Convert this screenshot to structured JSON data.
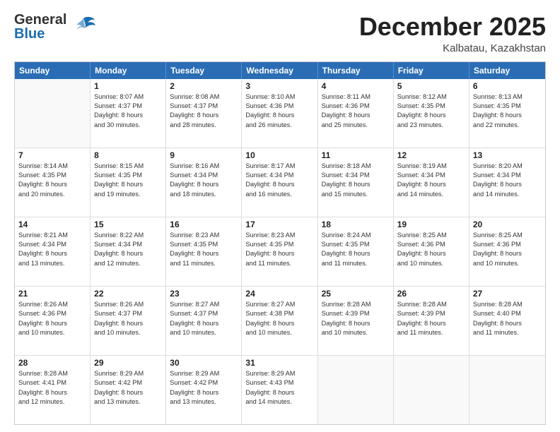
{
  "logo": {
    "line1": "General",
    "line2": "Blue"
  },
  "title": "December 2025",
  "location": "Kalbatau, Kazakhstan",
  "header_days": [
    "Sunday",
    "Monday",
    "Tuesday",
    "Wednesday",
    "Thursday",
    "Friday",
    "Saturday"
  ],
  "weeks": [
    [
      {
        "day": "",
        "sunrise": "",
        "sunset": "",
        "daylight": ""
      },
      {
        "day": "1",
        "sunrise": "Sunrise: 8:07 AM",
        "sunset": "Sunset: 4:37 PM",
        "daylight": "Daylight: 8 hours",
        "daylight2": "and 30 minutes."
      },
      {
        "day": "2",
        "sunrise": "Sunrise: 8:08 AM",
        "sunset": "Sunset: 4:37 PM",
        "daylight": "Daylight: 8 hours",
        "daylight2": "and 28 minutes."
      },
      {
        "day": "3",
        "sunrise": "Sunrise: 8:10 AM",
        "sunset": "Sunset: 4:36 PM",
        "daylight": "Daylight: 8 hours",
        "daylight2": "and 26 minutes."
      },
      {
        "day": "4",
        "sunrise": "Sunrise: 8:11 AM",
        "sunset": "Sunset: 4:36 PM",
        "daylight": "Daylight: 8 hours",
        "daylight2": "and 25 minutes."
      },
      {
        "day": "5",
        "sunrise": "Sunrise: 8:12 AM",
        "sunset": "Sunset: 4:35 PM",
        "daylight": "Daylight: 8 hours",
        "daylight2": "and 23 minutes."
      },
      {
        "day": "6",
        "sunrise": "Sunrise: 8:13 AM",
        "sunset": "Sunset: 4:35 PM",
        "daylight": "Daylight: 8 hours",
        "daylight2": "and 22 minutes."
      }
    ],
    [
      {
        "day": "7",
        "sunrise": "Sunrise: 8:14 AM",
        "sunset": "Sunset: 4:35 PM",
        "daylight": "Daylight: 8 hours",
        "daylight2": "and 20 minutes."
      },
      {
        "day": "8",
        "sunrise": "Sunrise: 8:15 AM",
        "sunset": "Sunset: 4:35 PM",
        "daylight": "Daylight: 8 hours",
        "daylight2": "and 19 minutes."
      },
      {
        "day": "9",
        "sunrise": "Sunrise: 8:16 AM",
        "sunset": "Sunset: 4:34 PM",
        "daylight": "Daylight: 8 hours",
        "daylight2": "and 18 minutes."
      },
      {
        "day": "10",
        "sunrise": "Sunrise: 8:17 AM",
        "sunset": "Sunset: 4:34 PM",
        "daylight": "Daylight: 8 hours",
        "daylight2": "and 16 minutes."
      },
      {
        "day": "11",
        "sunrise": "Sunrise: 8:18 AM",
        "sunset": "Sunset: 4:34 PM",
        "daylight": "Daylight: 8 hours",
        "daylight2": "and 15 minutes."
      },
      {
        "day": "12",
        "sunrise": "Sunrise: 8:19 AM",
        "sunset": "Sunset: 4:34 PM",
        "daylight": "Daylight: 8 hours",
        "daylight2": "and 14 minutes."
      },
      {
        "day": "13",
        "sunrise": "Sunrise: 8:20 AM",
        "sunset": "Sunset: 4:34 PM",
        "daylight": "Daylight: 8 hours",
        "daylight2": "and 14 minutes."
      }
    ],
    [
      {
        "day": "14",
        "sunrise": "Sunrise: 8:21 AM",
        "sunset": "Sunset: 4:34 PM",
        "daylight": "Daylight: 8 hours",
        "daylight2": "and 13 minutes."
      },
      {
        "day": "15",
        "sunrise": "Sunrise: 8:22 AM",
        "sunset": "Sunset: 4:34 PM",
        "daylight": "Daylight: 8 hours",
        "daylight2": "and 12 minutes."
      },
      {
        "day": "16",
        "sunrise": "Sunrise: 8:23 AM",
        "sunset": "Sunset: 4:35 PM",
        "daylight": "Daylight: 8 hours",
        "daylight2": "and 11 minutes."
      },
      {
        "day": "17",
        "sunrise": "Sunrise: 8:23 AM",
        "sunset": "Sunset: 4:35 PM",
        "daylight": "Daylight: 8 hours",
        "daylight2": "and 11 minutes."
      },
      {
        "day": "18",
        "sunrise": "Sunrise: 8:24 AM",
        "sunset": "Sunset: 4:35 PM",
        "daylight": "Daylight: 8 hours",
        "daylight2": "and 11 minutes."
      },
      {
        "day": "19",
        "sunrise": "Sunrise: 8:25 AM",
        "sunset": "Sunset: 4:36 PM",
        "daylight": "Daylight: 8 hours",
        "daylight2": "and 10 minutes."
      },
      {
        "day": "20",
        "sunrise": "Sunrise: 8:25 AM",
        "sunset": "Sunset: 4:36 PM",
        "daylight": "Daylight: 8 hours",
        "daylight2": "and 10 minutes."
      }
    ],
    [
      {
        "day": "21",
        "sunrise": "Sunrise: 8:26 AM",
        "sunset": "Sunset: 4:36 PM",
        "daylight": "Daylight: 8 hours",
        "daylight2": "and 10 minutes."
      },
      {
        "day": "22",
        "sunrise": "Sunrise: 8:26 AM",
        "sunset": "Sunset: 4:37 PM",
        "daylight": "Daylight: 8 hours",
        "daylight2": "and 10 minutes."
      },
      {
        "day": "23",
        "sunrise": "Sunrise: 8:27 AM",
        "sunset": "Sunset: 4:37 PM",
        "daylight": "Daylight: 8 hours",
        "daylight2": "and 10 minutes."
      },
      {
        "day": "24",
        "sunrise": "Sunrise: 8:27 AM",
        "sunset": "Sunset: 4:38 PM",
        "daylight": "Daylight: 8 hours",
        "daylight2": "and 10 minutes."
      },
      {
        "day": "25",
        "sunrise": "Sunrise: 8:28 AM",
        "sunset": "Sunset: 4:39 PM",
        "daylight": "Daylight: 8 hours",
        "daylight2": "and 10 minutes."
      },
      {
        "day": "26",
        "sunrise": "Sunrise: 8:28 AM",
        "sunset": "Sunset: 4:39 PM",
        "daylight": "Daylight: 8 hours",
        "daylight2": "and 11 minutes."
      },
      {
        "day": "27",
        "sunrise": "Sunrise: 8:28 AM",
        "sunset": "Sunset: 4:40 PM",
        "daylight": "Daylight: 8 hours",
        "daylight2": "and 11 minutes."
      }
    ],
    [
      {
        "day": "28",
        "sunrise": "Sunrise: 8:28 AM",
        "sunset": "Sunset: 4:41 PM",
        "daylight": "Daylight: 8 hours",
        "daylight2": "and 12 minutes."
      },
      {
        "day": "29",
        "sunrise": "Sunrise: 8:29 AM",
        "sunset": "Sunset: 4:42 PM",
        "daylight": "Daylight: 8 hours",
        "daylight2": "and 13 minutes."
      },
      {
        "day": "30",
        "sunrise": "Sunrise: 8:29 AM",
        "sunset": "Sunset: 4:42 PM",
        "daylight": "Daylight: 8 hours",
        "daylight2": "and 13 minutes."
      },
      {
        "day": "31",
        "sunrise": "Sunrise: 8:29 AM",
        "sunset": "Sunset: 4:43 PM",
        "daylight": "Daylight: 8 hours",
        "daylight2": "and 14 minutes."
      },
      {
        "day": "",
        "sunrise": "",
        "sunset": "",
        "daylight": "",
        "daylight2": ""
      },
      {
        "day": "",
        "sunrise": "",
        "sunset": "",
        "daylight": "",
        "daylight2": ""
      },
      {
        "day": "",
        "sunrise": "",
        "sunset": "",
        "daylight": "",
        "daylight2": ""
      }
    ]
  ]
}
